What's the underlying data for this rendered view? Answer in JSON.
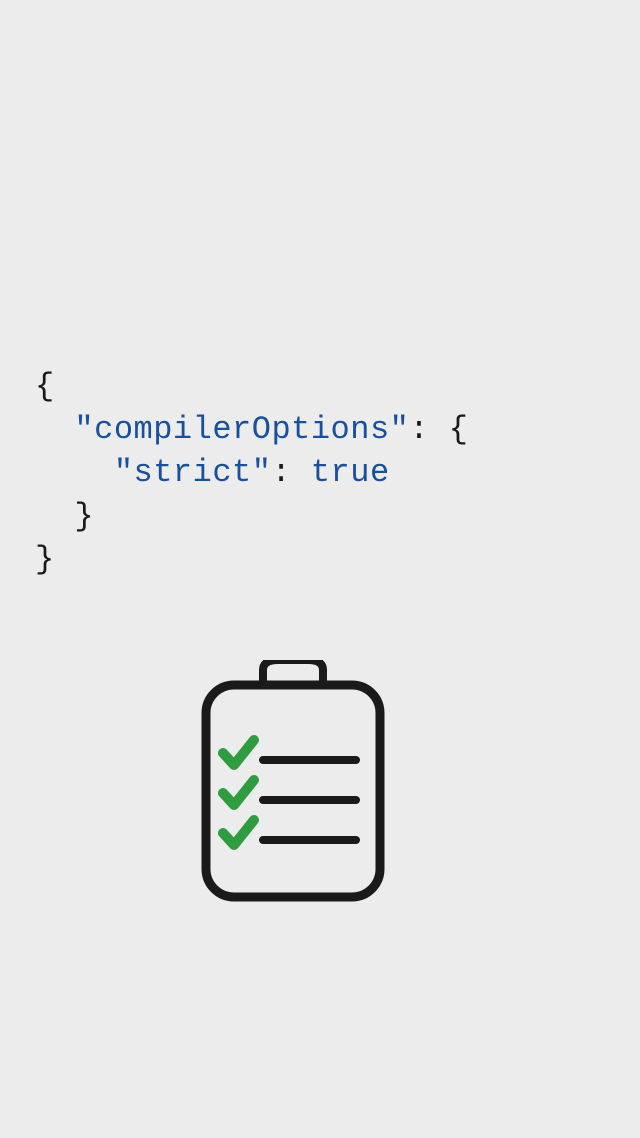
{
  "code": {
    "line1": "{",
    "line2_indent": "  ",
    "line2_key": "\"compilerOptions\"",
    "line2_colon": ": ",
    "line2_brace": "{",
    "line3_indent": "    ",
    "line3_key": "\"strict\"",
    "line3_colon": ": ",
    "line3_value": "true",
    "line4": "  }",
    "line5": "}"
  }
}
